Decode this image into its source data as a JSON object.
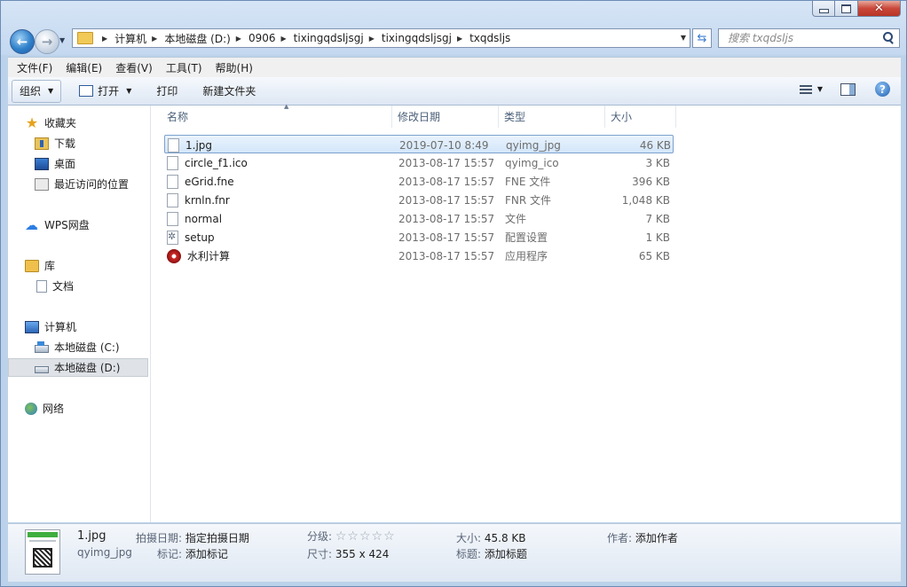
{
  "window": {
    "caption": {
      "close": "✕"
    }
  },
  "nav": {
    "back": "←",
    "forward": "→",
    "breadcrumb": [
      "计算机",
      "本地磁盘 (D:)",
      "0906",
      "tixingqdsljsgj",
      "tixingqdsljsgj",
      "txqdsljs"
    ],
    "search_placeholder": "搜索 txqdsljs"
  },
  "menu": [
    "文件(F)",
    "编辑(E)",
    "查看(V)",
    "工具(T)",
    "帮助(H)"
  ],
  "toolbar": {
    "organize": "组织",
    "open": "打开",
    "print": "打印",
    "new_folder": "新建文件夹",
    "help": "?"
  },
  "sidebar": {
    "favorites": "收藏夹",
    "downloads": "下载",
    "desktop": "桌面",
    "recent": "最近访问的位置",
    "wps": "WPS网盘",
    "libraries": "库",
    "documents": "文档",
    "computer": "计算机",
    "drive_c": "本地磁盘 (C:)",
    "drive_d": "本地磁盘 (D:)",
    "network": "网络"
  },
  "columns": {
    "name": "名称",
    "date": "修改日期",
    "type": "类型",
    "size": "大小"
  },
  "files": [
    {
      "name": "1.jpg",
      "date": "2019-07-10 8:49",
      "type": "qyimg_jpg",
      "size": "46 KB"
    },
    {
      "name": "circle_f1.ico",
      "date": "2013-08-17 15:57",
      "type": "qyimg_ico",
      "size": "3 KB"
    },
    {
      "name": "eGrid.fne",
      "date": "2013-08-17 15:57",
      "type": "FNE 文件",
      "size": "396 KB"
    },
    {
      "name": "krnln.fnr",
      "date": "2013-08-17 15:57",
      "type": "FNR 文件",
      "size": "1,048 KB"
    },
    {
      "name": "normal",
      "date": "2013-08-17 15:57",
      "type": "文件",
      "size": "7 KB"
    },
    {
      "name": "setup",
      "date": "2013-08-17 15:57",
      "type": "配置设置",
      "size": "1 KB"
    },
    {
      "name": "水利计算",
      "date": "2013-08-17 15:57",
      "type": "应用程序",
      "size": "65 KB"
    }
  ],
  "details": {
    "filename": "1.jpg",
    "filetype": "qyimg_jpg",
    "shoot_date_label": "拍摄日期:",
    "shoot_date_value": "指定拍摄日期",
    "tags_label": "标记:",
    "tags_value": "添加标记",
    "rating_label": "分级:",
    "rating_stars": "☆☆☆☆☆",
    "dimensions_label": "尺寸:",
    "dimensions_value": "355 x 424",
    "size_label": "大小:",
    "size_value": "45.8 KB",
    "title_label": "标题:",
    "title_value": "添加标题",
    "author_label": "作者:",
    "author_value": "添加作者"
  }
}
